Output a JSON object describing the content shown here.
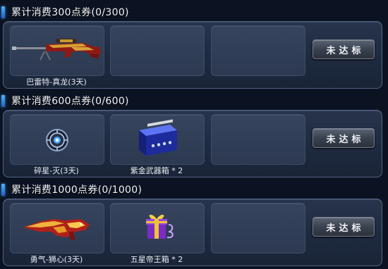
{
  "tiers": [
    {
      "title": "累计消费300点券(0/300)",
      "rewards": [
        {
          "label": "巴雷特-真龙(3天)",
          "icon": "rifle-icon"
        }
      ],
      "button_label": "未达标"
    },
    {
      "title": "累计消费600点券(0/600)",
      "rewards": [
        {
          "label": "碎星-灭(3天)",
          "icon": "orb-grenade-icon"
        },
        {
          "label": "紫金武器箱 * 2",
          "icon": "weapon-box-icon"
        }
      ],
      "button_label": "未达标"
    },
    {
      "title": "累计消费1000点券(0/1000)",
      "rewards": [
        {
          "label": "勇气-狮心(3天)",
          "icon": "lion-gun-icon"
        },
        {
          "label": "五星帝王箱 * 2",
          "icon": "gift-box-icon"
        }
      ],
      "button_label": "未达标"
    }
  ],
  "colors": {
    "background": "#0b1322",
    "panel": "#1e2a3f",
    "slot": "#2c3951",
    "accent_blue": "#3d8fe6"
  }
}
